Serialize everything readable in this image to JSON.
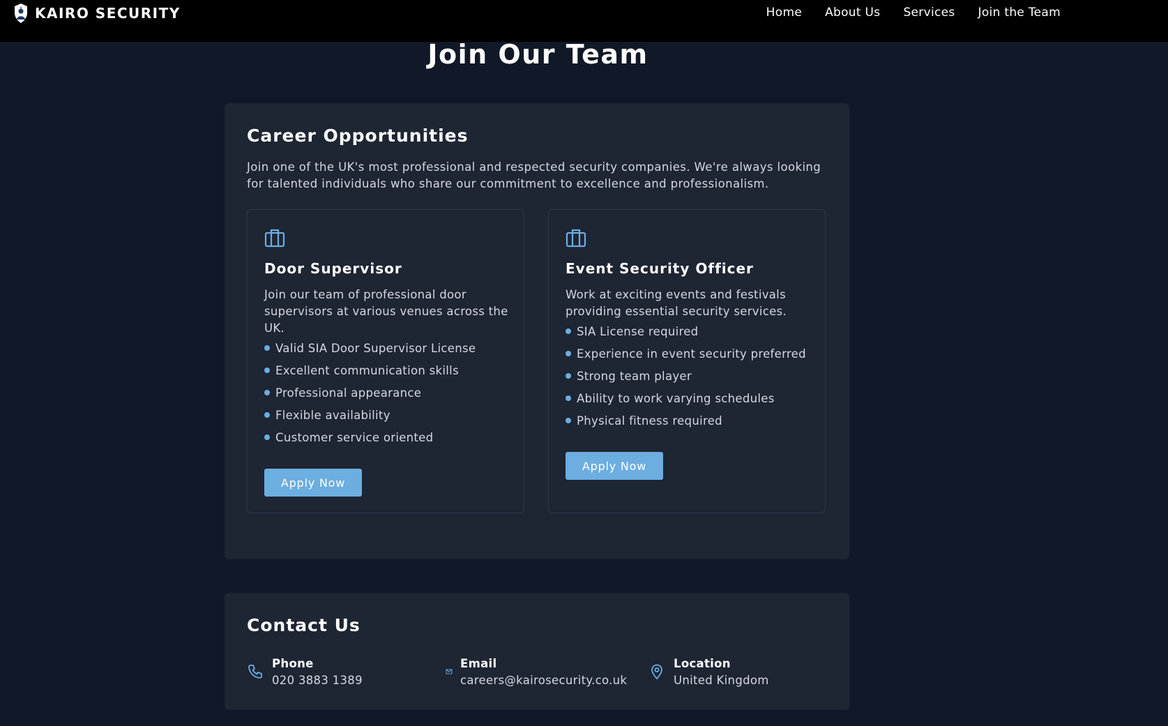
{
  "brand": {
    "name": "KAIRO SECURITY"
  },
  "nav": {
    "home": "Home",
    "about": "About Us",
    "services": "Services",
    "join": "Join the Team"
  },
  "page": {
    "title": "Join Our Team"
  },
  "careers": {
    "title": "Career Opportunities",
    "intro": "Join one of the UK's most professional and respected security companies. We're always looking for talented individuals who share our commitment to excellence and professionalism.",
    "jobs": [
      {
        "title": "Door Supervisor",
        "description": "Join our team of professional door supervisors at various venues across the UK.",
        "requirements": [
          "Valid SIA Door Supervisor License",
          "Excellent communication skills",
          "Professional appearance",
          "Flexible availability",
          "Customer service oriented"
        ],
        "apply_label": "Apply Now"
      },
      {
        "title": "Event Security Officer",
        "description": "Work at exciting events and festivals providing essential security services.",
        "requirements": [
          "SIA License required",
          "Experience in event security preferred",
          "Strong team player",
          "Ability to work varying schedules",
          "Physical fitness required"
        ],
        "apply_label": "Apply Now"
      }
    ]
  },
  "contact": {
    "title": "Contact Us",
    "phone": {
      "label": "Phone",
      "value": "020 3883 1389",
      "icon": "phone-icon"
    },
    "email": {
      "label": "Email",
      "value": "careers@kairosecurity.co.uk",
      "icon": "mail-icon"
    },
    "location": {
      "label": "Location",
      "value": "United Kingdom",
      "icon": "map-pin-icon"
    }
  },
  "colors": {
    "background": "#111827",
    "card": "#1e2533",
    "topbar": "#000000",
    "accent": "#6caee0"
  }
}
